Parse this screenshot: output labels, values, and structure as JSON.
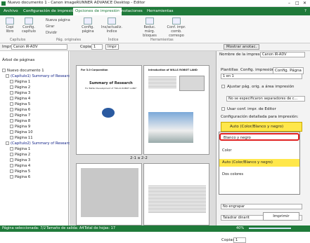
{
  "window": {
    "title": "Nuevo documento 1 - Canon imageRUNNER ADVANCE Desktop - Editor"
  },
  "ribbon_tabs": [
    "Archivo",
    "Configuración de impresión",
    "Opciones de impresión",
    "Anotaciones",
    "Herramientas"
  ],
  "ribbon": {
    "copia_libro": "Copi libro",
    "config_capitulo": "Config. capítulo",
    "nueva_pagina": "Nueva página",
    "girar": "Girar",
    "dividir": "Dividir",
    "config_pagina": "Config. página",
    "ins_actualiz": "Ins/actualiz. índice",
    "reduc_marg_bloques": "Reduc. márg. bloques",
    "conf_impr_comb": "Conf. impr. comb. correspo",
    "groups": [
      "Capítulos",
      "Pág. originales",
      "Índice",
      "Herramientas"
    ]
  },
  "toolbar": {
    "impr_label": "Impr",
    "printer_value": "Canon iR-ADV",
    "copias_label": "Copias",
    "copias_value": "1",
    "imprimir": "Impr",
    "mostrar_anotac": "Mostrar anotac."
  },
  "tree": {
    "header": "Árbol de páginas",
    "root": "Nuevo documento 1",
    "chapter1": "(Capítulo1) Summary of Research",
    "pages1": [
      "Página 1",
      "Página 2",
      "Página 3",
      "Página 4",
      "Página 5",
      "Página 6",
      "Página 7",
      "Página 8",
      "Página 9",
      "Página 10",
      "Página 11"
    ],
    "chapter2": "(Capítulo2) Summary of Research",
    "pages2": [
      "Página 1",
      "Página 2",
      "Página 3",
      "Página 4",
      "Página 5",
      "Página 6"
    ]
  },
  "preview": {
    "spread_label": "2-1 a 2-2",
    "page_left_title": "Summary of Research",
    "page_left_sub": "For Better Development of \"WILLS ROBOT LAND\"",
    "page_left_company": "For 3.0 Corporation",
    "page_right_title": "Introduction of WILLS ROBOT LAND"
  },
  "settings": {
    "printer_label": "Nombre de la impresora:",
    "printer_value": "Canon iR-ADV",
    "tabs": [
      "Plantillas",
      "Config. impresión",
      "Config. Págna"
    ],
    "one_in_one": "1 en 1",
    "ajustar": "Ajustar pág. orig. a área impresión",
    "separadores": "No se especificaron separadores de c...",
    "usar_conf": "Usar conf. impr. de Editor",
    "detallada": "Configuración detallada para impresión:",
    "color_selected": "Auto (Color/Blanco y negro)",
    "options": [
      "Blanco y negro",
      "Color",
      "Auto (Color/Blanco y negro)",
      "Dos colores"
    ],
    "no_engrapar": "No engrapar",
    "taladrar": "Taladrar dinarit",
    "copias_label": "Copias:",
    "copias_value": "1",
    "imprimir": "Imprimir"
  },
  "status": {
    "pagina_seleccionada": "Página seleccionada: 7/2",
    "tamano_salida": "Tamaño de salida: A4",
    "total_hojas": "Total de hojas: 17",
    "zoom": "40%"
  },
  "colors": {
    "accent": "#1f7a3a",
    "highlight": "#ffe74a",
    "select_border": "#e02020"
  }
}
